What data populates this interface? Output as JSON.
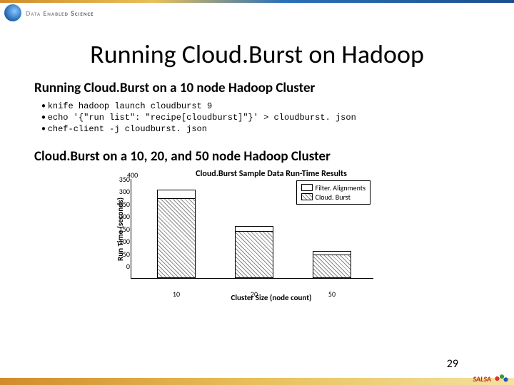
{
  "brand": {
    "top_text": "Data Enabled Science"
  },
  "title": "Running Cloud.Burst on Hadoop",
  "section1": {
    "heading": "Running Cloud.Burst on a 10 node Hadoop Cluster",
    "cmds": [
      "knife hadoop launch cloudburst 9",
      "echo '{\"run list\": \"recipe[cloudburst]\"}' > cloudburst. json",
      "chef-client -j cloudburst. json"
    ]
  },
  "section2": {
    "heading": "Cloud.Burst on a 10, 20, and 50 node Hadoop Cluster"
  },
  "chart_data": {
    "type": "bar",
    "title": "Cloud.Burst Sample Data Run-Time Results",
    "xlabel": "Cluster Size (node count)",
    "ylabel": "Run Time (seconds)",
    "ylim": [
      0,
      400
    ],
    "yticks": [
      0,
      50,
      100,
      150,
      200,
      250,
      300,
      350,
      400
    ],
    "categories": [
      "10",
      "20",
      "50"
    ],
    "series": [
      {
        "name": "Filter. Alignments",
        "values": [
          355,
          210,
          110
        ]
      },
      {
        "name": "Cloud. Burst",
        "values": [
          320,
          190,
          95
        ]
      }
    ],
    "legend": [
      "Filter. Alignments",
      "Cloud. Burst"
    ]
  },
  "page_number": "29",
  "footer_logo": "SALSA"
}
